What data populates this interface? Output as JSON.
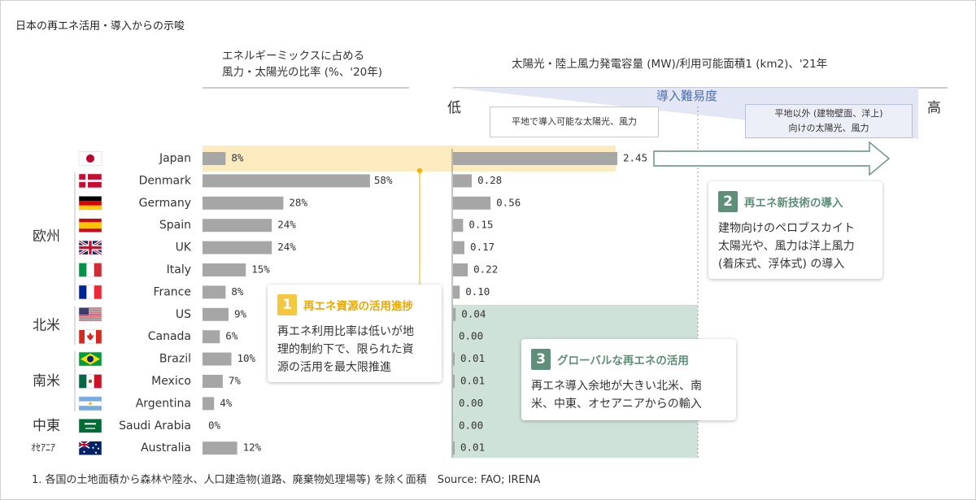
{
  "title": "日本の再エネ活用・導入からの示唆",
  "left_header": [
    "エネルギーミックスに占める",
    "風力・太陽光の比率 (%、'20年)"
  ],
  "right_header": "太陽光・陸上風力発電容量 (MW)/利用可能面積1 (km2)、'21年",
  "difficulty": {
    "label": "導入難易度",
    "low": "低",
    "high": "高"
  },
  "flat_label": "平地で導入可能な太陽光、風力",
  "nonflat_label": [
    "平地以外 (建物壁面、洋上)",
    "向けの太陽光、風力"
  ],
  "colors": {
    "bar": "#a6a6a6",
    "highlight": "#fdebc0",
    "green_shade": "#cfe2d9",
    "card1": "#f5c842",
    "card2": "#5d8f7a",
    "card3": "#5d8f7a",
    "accent": "#4a6fb0"
  },
  "regions": [
    {
      "name": "欧州",
      "rows": [
        1,
        6
      ]
    },
    {
      "name": "北米",
      "rows": [
        7,
        8
      ]
    },
    {
      "name": "南米",
      "rows": [
        9,
        11
      ]
    },
    {
      "name": "中東",
      "rows": [
        12,
        12
      ]
    },
    {
      "name": "ｵｾｱﾆｱ",
      "rows": [
        13,
        13
      ]
    }
  ],
  "flags": [
    "japan-flag",
    "denmark-flag",
    "germany-flag",
    "spain-flag",
    "uk-flag",
    "italy-flag",
    "france-flag",
    "us-flag",
    "canada-flag",
    "brazil-flag",
    "mexico-flag",
    "argentina-flag",
    "saudi-arabia-flag",
    "australia-flag"
  ],
  "card1": {
    "num": "1",
    "title": "再エネ資源の活用進捗",
    "lines": [
      "再エネ利用比率は低いが地",
      "理的制約下で、限られた資",
      "源の活用を最大限推進"
    ]
  },
  "card2": {
    "num": "2",
    "title": "再エネ新技術の導入",
    "lines": [
      "建物向けのペロブスカイト",
      "太陽光や、風力は洋上風力",
      "(着床式、浮体式) の導入"
    ]
  },
  "card3": {
    "num": "3",
    "title": "グローバルな再エネの活用",
    "lines": [
      "再エネ導入余地が大きい北米、南",
      "米、中東、オセアニアからの輸入"
    ]
  },
  "footnote": "1. 各国の土地面積から森林や陸水、人口建造物(道路、廃棄物処理場等) を除く面積　Source: FAO; IRENA",
  "chart_data": [
    {
      "type": "bar",
      "orientation": "horizontal",
      "title": "エネルギーミックスに占める風力・太陽光の比率 (%、'20年)",
      "categories": [
        "Japan",
        "Denmark",
        "Germany",
        "Spain",
        "UK",
        "Italy",
        "France",
        "US",
        "Canada",
        "Brazil",
        "Mexico",
        "Argentina",
        "Saudi Arabia",
        "Australia"
      ],
      "values": [
        8,
        58,
        28,
        24,
        24,
        15,
        8,
        9,
        6,
        10,
        7,
        4,
        0,
        12
      ],
      "value_labels": [
        "8%",
        "58%",
        "28%",
        "24%",
        "24%",
        "15%",
        "8%",
        "9%",
        "6%",
        "10%",
        "7%",
        "4%",
        "0%",
        "12%"
      ],
      "xlim": [
        0,
        100
      ],
      "grid": false
    },
    {
      "type": "bar",
      "orientation": "horizontal",
      "title": "太陽光・陸上風力発電容量 (MW)/利用可能面積1 (km2)、'21年",
      "categories": [
        "Japan",
        "Denmark",
        "Germany",
        "Spain",
        "UK",
        "Italy",
        "France",
        "US",
        "Canada",
        "Brazil",
        "Mexico",
        "Argentina",
        "Saudi Arabia",
        "Australia"
      ],
      "values": [
        2.45,
        0.28,
        0.56,
        0.15,
        0.17,
        0.22,
        0.1,
        0.04,
        0.0,
        0.01,
        0.01,
        0.0,
        0.0,
        0.01
      ],
      "value_labels": [
        "2.45",
        "0.28",
        "0.56",
        "0.15",
        "0.17",
        "0.22",
        "0.10",
        "0.04",
        "0.00",
        "0.01",
        "0.01",
        "0.00",
        "0.00",
        "0.01"
      ],
      "xlim": [
        0,
        2.45
      ],
      "grid": false
    }
  ]
}
